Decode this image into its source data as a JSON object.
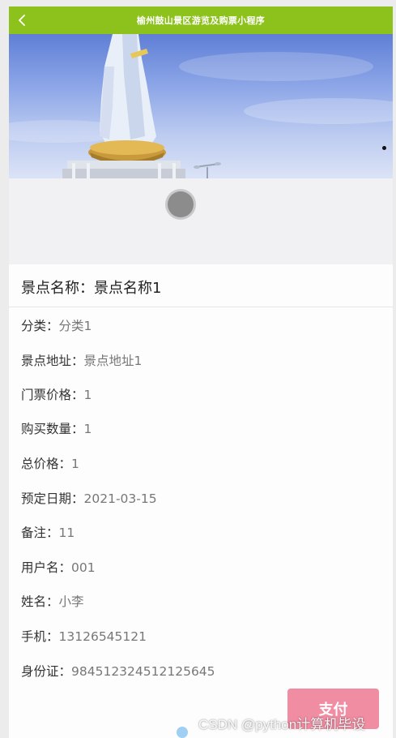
{
  "navbar": {
    "title": "榆州鼓山景区游览及购票小程序",
    "back_icon": "chevron-left-icon",
    "background_color": "#8cc21b"
  },
  "banner": {
    "image": "guanyin-statue-photo",
    "pagination_dot_icon": "carousel-dot-icon"
  },
  "loading": {
    "icon": "loading-spinner-icon"
  },
  "detail": {
    "title_label": "景点名称：",
    "title_value": "景点名称1",
    "fields": [
      {
        "label": "分类：",
        "value": "分类1"
      },
      {
        "label": "景点地址：",
        "value": "景点地址1"
      },
      {
        "label": "门票价格：",
        "value": "1"
      },
      {
        "label": "购买数量：",
        "value": "1"
      },
      {
        "label": "总价格：",
        "value": "1"
      },
      {
        "label": "预定日期：",
        "value": "2021-03-15"
      },
      {
        "label": "备注：",
        "value": "11"
      },
      {
        "label": "用户名：",
        "value": "001"
      },
      {
        "label": "姓名：",
        "value": "小李"
      },
      {
        "label": "手机：",
        "value": "13126545121"
      },
      {
        "label": "身份证：",
        "value": "984512324512125645"
      }
    ]
  },
  "actions": {
    "pay_label": "支付",
    "pay_color": "#f18da3"
  },
  "watermark": "CSDN @python计算机毕设"
}
